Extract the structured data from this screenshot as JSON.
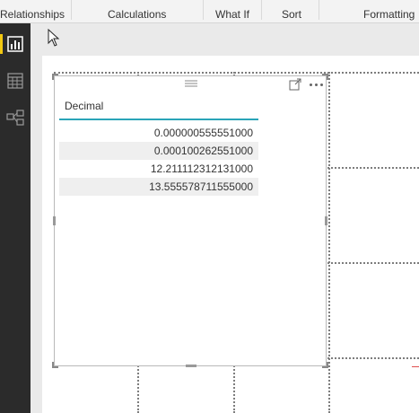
{
  "ribbon": {
    "groups": [
      "Relationships",
      "Calculations",
      "What If",
      "Sort",
      "Formatting"
    ]
  },
  "leftnav": {
    "items": [
      {
        "name": "report-view",
        "icon": "bar-chart-icon",
        "active": true
      },
      {
        "name": "data-view",
        "icon": "table-grid-icon",
        "active": false
      },
      {
        "name": "relationships-view",
        "icon": "relationship-model-icon",
        "active": false
      }
    ]
  },
  "visual": {
    "icons": [
      "focus-mode-icon",
      "more-options-icon"
    ],
    "table": {
      "column": "Decimal",
      "rows": [
        "0.000000555551000",
        "0.000100262551000",
        "12.211112312131000",
        "13.555578711555000"
      ]
    }
  },
  "colors": {
    "accent": "#2aa4b8",
    "nav_bg": "#2b2b2b",
    "active_indicator": "#f2c811"
  }
}
